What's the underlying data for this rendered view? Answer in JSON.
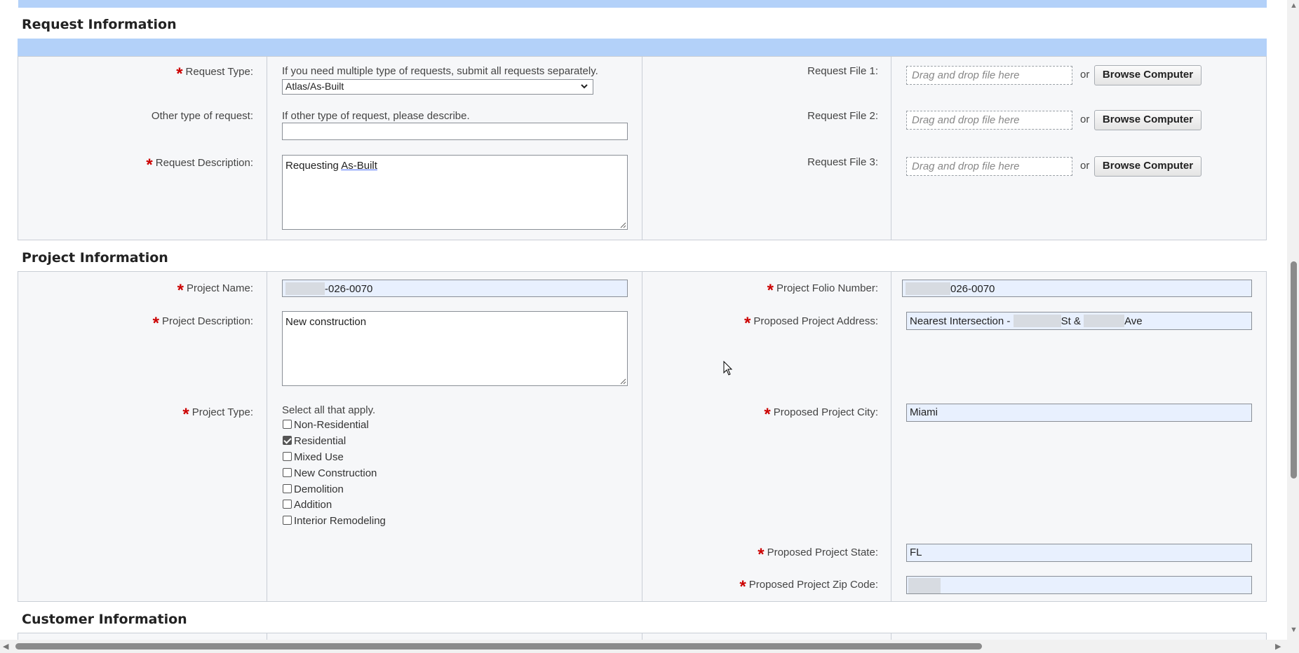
{
  "request_section": {
    "title": "Request Information",
    "request_type": {
      "label": "Request Type:",
      "hint": "If you need multiple type of requests, submit all requests separately.",
      "value": "Atlas/As-Built"
    },
    "other_type": {
      "label": "Other type of request:",
      "hint": "If other type of request, please describe.",
      "value": ""
    },
    "description": {
      "label": "Request Description:",
      "value_prefix": "Requesting ",
      "value_underlined": "As-Built"
    },
    "files": [
      {
        "label": "Request File 1:",
        "placeholder": "Drag and drop file here",
        "or": "or",
        "button": "Browse Computer"
      },
      {
        "label": "Request File 2:",
        "placeholder": "Drag and drop file here",
        "or": "or",
        "button": "Browse Computer"
      },
      {
        "label": "Request File 3:",
        "placeholder": "Drag and drop file here",
        "or": "or",
        "button": "Browse Computer"
      }
    ]
  },
  "project_section": {
    "title": "Project Information",
    "name": {
      "label": "Project Name:",
      "value": "-026-0070"
    },
    "description": {
      "label": "Project Description:",
      "value": "New construction"
    },
    "type": {
      "label": "Project Type:",
      "hint": "Select all that apply.",
      "options": [
        {
          "label": "Non-Residential",
          "checked": false
        },
        {
          "label": "Residential",
          "checked": true
        },
        {
          "label": "Mixed Use",
          "checked": false
        },
        {
          "label": "New Construction",
          "checked": false
        },
        {
          "label": "Demolition",
          "checked": false
        },
        {
          "label": "Addition",
          "checked": false
        },
        {
          "label": "Interior Remodeling",
          "checked": false
        }
      ]
    },
    "folio": {
      "label": "Project Folio Number:",
      "value": "026-0070"
    },
    "address": {
      "label": "Proposed Project Address:",
      "value_a": "Nearest Intersection - ",
      "value_b": "St & ",
      "value_c": "Ave"
    },
    "city": {
      "label": "Proposed Project City:",
      "value": "Miami"
    },
    "state": {
      "label": "Proposed Project State:",
      "value": "FL"
    },
    "zip": {
      "label": "Proposed Project Zip Code:",
      "value": ""
    }
  },
  "customer_section": {
    "title": "Customer Information"
  },
  "colors": {
    "accent_band": "#b3d1f9",
    "required": "#cc0000",
    "autofill_bg": "#e8f0fe"
  }
}
